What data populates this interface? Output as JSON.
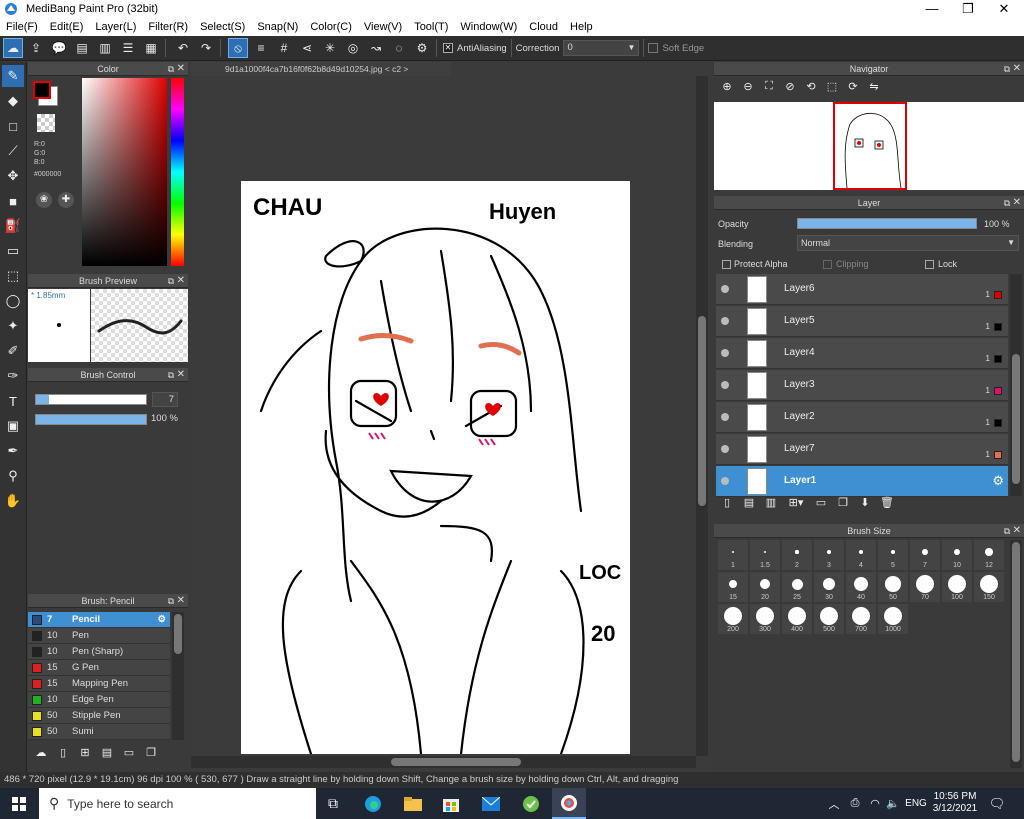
{
  "titlebar": {
    "title": "MediBang Paint Pro (32bit)",
    "min": "—",
    "max": "❐",
    "close": "✕"
  },
  "menu": [
    "File(F)",
    "Edit(E)",
    "Layer(L)",
    "Filter(R)",
    "Select(S)",
    "Snap(N)",
    "Color(C)",
    "View(V)",
    "Tool(T)",
    "Window(W)",
    "Cloud",
    "Help"
  ],
  "toolbar": {
    "antialias_label": "AntiAliasing",
    "correction_label": "Correction",
    "correction_value": "0",
    "softedge_label": "Soft Edge"
  },
  "color_panel": {
    "title": "Color",
    "r": "R:0",
    "g": "G:0",
    "b": "B:0",
    "hex": "#000000",
    "fg": "#000000",
    "bg": "#ffffff",
    "accent_red": "#e00000"
  },
  "brush_preview": {
    "title": "Brush Preview",
    "size": "* 1.85mm"
  },
  "brush_control": {
    "title": "Brush Control",
    "size_value": "7",
    "opacity_value": "100 %"
  },
  "brush_list": {
    "title": "Brush: Pencil",
    "items": [
      {
        "size": "7",
        "name": "Pencil",
        "color": "#2b4b7c"
      },
      {
        "size": "10",
        "name": "Pen",
        "color": "#222222"
      },
      {
        "size": "10",
        "name": "Pen (Sharp)",
        "color": "#222222"
      },
      {
        "size": "15",
        "name": "G Pen",
        "color": "#e02020"
      },
      {
        "size": "15",
        "name": "Mapping Pen",
        "color": "#e02020"
      },
      {
        "size": "10",
        "name": "Edge Pen",
        "color": "#20b020"
      },
      {
        "size": "50",
        "name": "Stipple Pen",
        "color": "#e8e020"
      },
      {
        "size": "50",
        "name": "Sumi",
        "color": "#e8e020"
      }
    ]
  },
  "document": {
    "tab": "9d1a1000f4ca7b16f0f62b8d49d10254.jpg < c2 >"
  },
  "artwork_text": {
    "name1": "CHAU",
    "name2": "Huyen",
    "word3": "LOC",
    "num": "20"
  },
  "navigator": {
    "title": "Navigator"
  },
  "layer_panel": {
    "title": "Layer",
    "opacity_label": "Opacity",
    "opacity_value": "100 %",
    "blending_label": "Blending",
    "blending_value": "Normal",
    "protect_alpha": "Protect Alpha",
    "clipping": "Clipping",
    "lock": "Lock",
    "layers": [
      {
        "name": "Layer6",
        "num": "1",
        "color": "#e00000"
      },
      {
        "name": "Layer5",
        "num": "1",
        "color": "#000000"
      },
      {
        "name": "Layer4",
        "num": "1",
        "color": "#000000"
      },
      {
        "name": "Layer3",
        "num": "1",
        "color": "#e0106a"
      },
      {
        "name": "Layer2",
        "num": "1",
        "color": "#000000"
      },
      {
        "name": "Layer7",
        "num": "1",
        "color": "#e07050"
      },
      {
        "name": "Layer1",
        "num": "",
        "color": ""
      }
    ]
  },
  "brush_size": {
    "title": "Brush Size",
    "sizes": [
      "1",
      "1.5",
      "2",
      "3",
      "4",
      "5",
      "7",
      "10",
      "12",
      "15",
      "20",
      "25",
      "30",
      "40",
      "50",
      "70",
      "100",
      "150",
      "200",
      "300",
      "400",
      "500",
      "700",
      "1000"
    ]
  },
  "status": {
    "text": "486 * 720 pixel  (12.9 * 19.1cm)  96 dpi   100 %   ( 530, 677 )   Draw a straight line by holding down Shift, Change a brush size by holding down Ctrl, Alt, and dragging"
  },
  "taskbar": {
    "search_placeholder": "Type here to search",
    "lang": "ENG",
    "time": "10:56 PM",
    "date": "3/12/2021"
  }
}
